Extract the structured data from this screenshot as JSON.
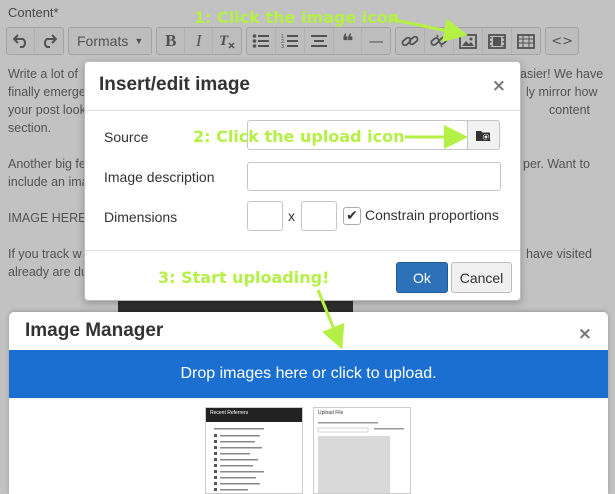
{
  "content_label": "Content*",
  "toolbar": {
    "formats_label": "Formats",
    "bold": "B",
    "italic": "I",
    "clear": "Tx",
    "quote": "❝",
    "hr": "—",
    "code": "<>"
  },
  "editor_lines": [
    "Write a lot of",
    "finally emerge",
    "your post look",
    "section.",
    "Another big fe",
    "include an ima",
    "IMAGE HERE",
    "If you track w",
    "already are du"
  ],
  "editor_right": [
    "asier! We have",
    "ly mirror how",
    "content",
    "per. Want to",
    "have visited"
  ],
  "dialog": {
    "title": "Insert/edit image",
    "close": "×",
    "source_label": "Source",
    "description_label": "Image description",
    "dimensions_label": "Dimensions",
    "x_sep": "x",
    "constrain_label": "Constrain proportions",
    "constrain_checked": "✔",
    "ok_label": "Ok",
    "cancel_label": "Cancel"
  },
  "image_manager": {
    "title": "Image Manager",
    "close": "×",
    "drop_text": "Drop images here or click to upload.",
    "thumb1_heading": "Recent Referrers",
    "thumb2_heading": "Upload File"
  },
  "annotations": {
    "step1": "1: Click the image icon",
    "step2": "2: Click the upload icon",
    "step3": "3: Start uploading!"
  },
  "colors": {
    "annotation": "#b5f046",
    "ok_button": "#2d72b8",
    "drop_zone": "#1a6fd0"
  }
}
